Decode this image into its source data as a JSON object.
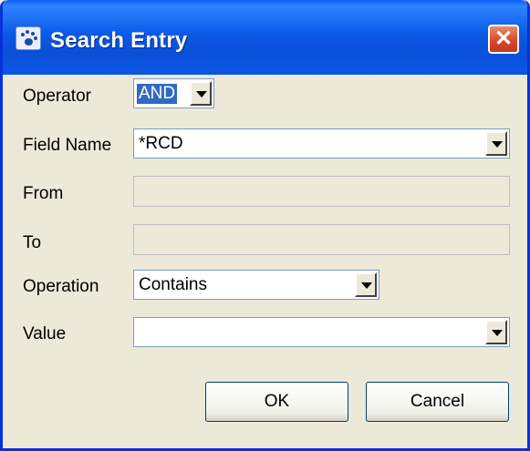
{
  "window": {
    "title": "Search Entry",
    "close_label": "✕"
  },
  "form": {
    "operator": {
      "label": "Operator",
      "value": "AND"
    },
    "field_name": {
      "label": "Field Name",
      "value": "*RCD"
    },
    "from": {
      "label": "From",
      "value": ""
    },
    "to": {
      "label": "To",
      "value": ""
    },
    "operation": {
      "label": "Operation",
      "value": "Contains"
    },
    "value": {
      "label": "Value",
      "value": ""
    }
  },
  "buttons": {
    "ok": "OK",
    "cancel": "Cancel"
  }
}
